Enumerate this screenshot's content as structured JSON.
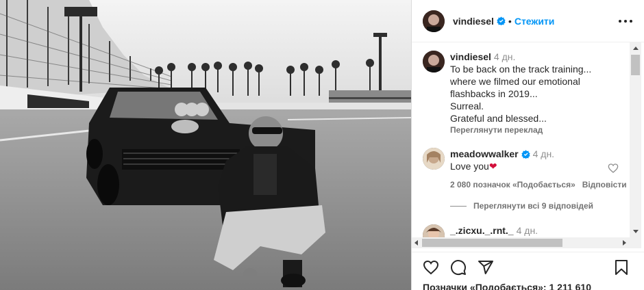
{
  "post": {
    "author": "vindiesel",
    "follow_label": "Стежити",
    "dot": "•",
    "likes_label": "Позначки «Подобається»: 1 211 610"
  },
  "icons": {
    "verified": "verified-badge-icon",
    "more": "more-options-icon",
    "like": "heart-icon",
    "comment": "comment-icon",
    "share": "share-icon",
    "save": "bookmark-icon"
  },
  "colors": {
    "accent": "#0095f6",
    "heart": "#d3103c",
    "meta": "#737373"
  },
  "caption": {
    "user": "vindiesel",
    "time": "4 дн.",
    "lines": [
      "To be back on the track training...",
      "where we filmed our emotional",
      "flashbacks in 2019...",
      "Surreal.",
      "Grateful and blessed..."
    ],
    "translate": "Переглянути переклад"
  },
  "comments": [
    {
      "user": "meadowwalker",
      "time": "4 дн.",
      "text": "Love you",
      "heart": "❤",
      "likes": "2 080 позначок «Подобається»",
      "reply": "Відповісти",
      "view_replies": "Переглянути всі 9 відповідей"
    },
    {
      "user": "_.zicxu._.rnt._",
      "time": "4 дн."
    }
  ]
}
